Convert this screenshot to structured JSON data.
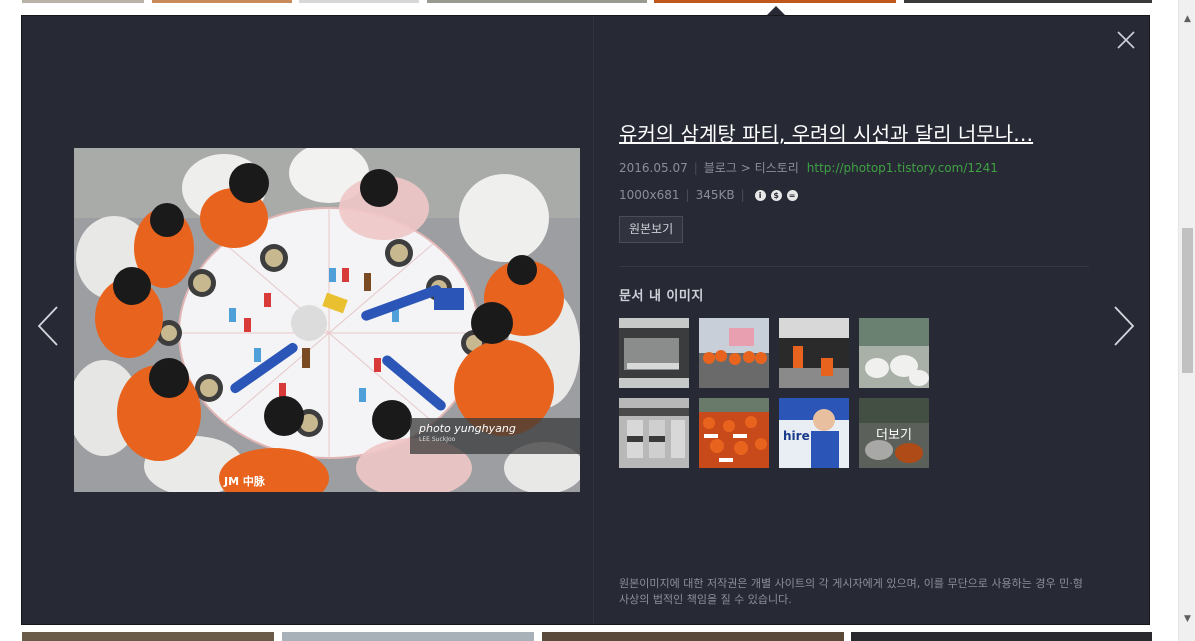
{
  "viewer": {
    "title": "유커의 삼계탕 파티, 우려의 시선과 달리 너무나…",
    "date": "2016.05.07",
    "source_type": "블로그",
    "source_arrow": ">",
    "source_name": "티스토리",
    "source_url": "http://photop1.tistory.com/1241",
    "dimensions": "1000x681",
    "file_size": "345KB",
    "license_icons": [
      "creative-commons-icon",
      "non-commercial-icon",
      "no-derivatives-icon"
    ],
    "original_button": "원본보기",
    "section_title": "문서 내 이미지",
    "more_label": "더보기",
    "copyright_notice": "원본이미지에 대한 저작권은 개별 사이트의 각 게시자에게 있으며, 이를 무단으로 사용하는 경우 민·형사상의 법적인 책임을 질 수 있습니다.",
    "watermark_line1": "photo yunghyang",
    "watermark_line2": "LEE SuckJoo",
    "jacket_text": "JM 中脉"
  },
  "icons": {
    "close": "close-icon",
    "prev": "chevron-left-icon",
    "next": "chevron-right-icon",
    "scroll_up": "arrow-up-icon",
    "scroll_down": "arrow-down-icon"
  },
  "colors": {
    "viewer_bg": "#272a35",
    "url_green": "#3fa143",
    "text_muted": "#8b8e99",
    "orange": "#e8641e"
  }
}
